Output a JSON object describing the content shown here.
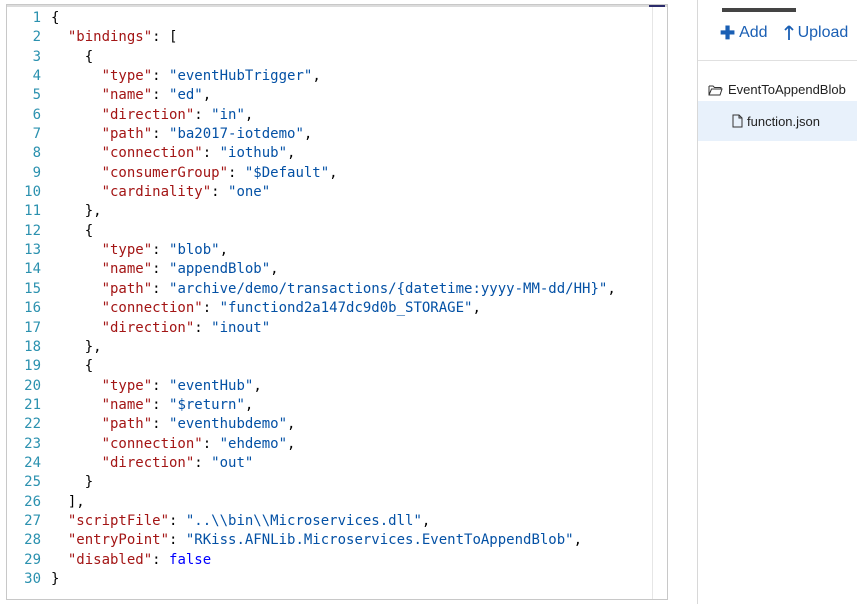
{
  "editor": {
    "lines": [
      [
        {
          "t": "p",
          "v": "{"
        }
      ],
      [
        {
          "t": "p",
          "v": "  "
        },
        {
          "t": "k",
          "v": "\"bindings\""
        },
        {
          "t": "p",
          "v": ": ["
        }
      ],
      [
        {
          "t": "p",
          "v": "    {"
        }
      ],
      [
        {
          "t": "p",
          "v": "      "
        },
        {
          "t": "k",
          "v": "\"type\""
        },
        {
          "t": "p",
          "v": ": "
        },
        {
          "t": "s",
          "v": "\"eventHubTrigger\""
        },
        {
          "t": "p",
          "v": ","
        }
      ],
      [
        {
          "t": "p",
          "v": "      "
        },
        {
          "t": "k",
          "v": "\"name\""
        },
        {
          "t": "p",
          "v": ": "
        },
        {
          "t": "s",
          "v": "\"ed\""
        },
        {
          "t": "p",
          "v": ","
        }
      ],
      [
        {
          "t": "p",
          "v": "      "
        },
        {
          "t": "k",
          "v": "\"direction\""
        },
        {
          "t": "p",
          "v": ": "
        },
        {
          "t": "s",
          "v": "\"in\""
        },
        {
          "t": "p",
          "v": ","
        }
      ],
      [
        {
          "t": "p",
          "v": "      "
        },
        {
          "t": "k",
          "v": "\"path\""
        },
        {
          "t": "p",
          "v": ": "
        },
        {
          "t": "s",
          "v": "\"ba2017-iotdemo\""
        },
        {
          "t": "p",
          "v": ","
        }
      ],
      [
        {
          "t": "p",
          "v": "      "
        },
        {
          "t": "k",
          "v": "\"connection\""
        },
        {
          "t": "p",
          "v": ": "
        },
        {
          "t": "s",
          "v": "\"iothub\""
        },
        {
          "t": "p",
          "v": ","
        }
      ],
      [
        {
          "t": "p",
          "v": "      "
        },
        {
          "t": "k",
          "v": "\"consumerGroup\""
        },
        {
          "t": "p",
          "v": ": "
        },
        {
          "t": "s",
          "v": "\"$Default\""
        },
        {
          "t": "p",
          "v": ","
        }
      ],
      [
        {
          "t": "p",
          "v": "      "
        },
        {
          "t": "k",
          "v": "\"cardinality\""
        },
        {
          "t": "p",
          "v": ": "
        },
        {
          "t": "s",
          "v": "\"one\""
        }
      ],
      [
        {
          "t": "p",
          "v": "    },"
        }
      ],
      [
        {
          "t": "p",
          "v": "    {"
        }
      ],
      [
        {
          "t": "p",
          "v": "      "
        },
        {
          "t": "k",
          "v": "\"type\""
        },
        {
          "t": "p",
          "v": ": "
        },
        {
          "t": "s",
          "v": "\"blob\""
        },
        {
          "t": "p",
          "v": ","
        }
      ],
      [
        {
          "t": "p",
          "v": "      "
        },
        {
          "t": "k",
          "v": "\"name\""
        },
        {
          "t": "p",
          "v": ": "
        },
        {
          "t": "s",
          "v": "\"appendBlob\""
        },
        {
          "t": "p",
          "v": ","
        }
      ],
      [
        {
          "t": "p",
          "v": "      "
        },
        {
          "t": "k",
          "v": "\"path\""
        },
        {
          "t": "p",
          "v": ": "
        },
        {
          "t": "s",
          "v": "\"archive/demo/transactions/{datetime:yyyy-MM-dd/HH}\""
        },
        {
          "t": "p",
          "v": ","
        }
      ],
      [
        {
          "t": "p",
          "v": "      "
        },
        {
          "t": "k",
          "v": "\"connection\""
        },
        {
          "t": "p",
          "v": ": "
        },
        {
          "t": "s",
          "v": "\"functiond2a147dc9d0b_STORAGE\""
        },
        {
          "t": "p",
          "v": ","
        }
      ],
      [
        {
          "t": "p",
          "v": "      "
        },
        {
          "t": "k",
          "v": "\"direction\""
        },
        {
          "t": "p",
          "v": ": "
        },
        {
          "t": "s",
          "v": "\"inout\""
        }
      ],
      [
        {
          "t": "p",
          "v": "    },"
        }
      ],
      [
        {
          "t": "p",
          "v": "    {"
        }
      ],
      [
        {
          "t": "p",
          "v": "      "
        },
        {
          "t": "k",
          "v": "\"type\""
        },
        {
          "t": "p",
          "v": ": "
        },
        {
          "t": "s",
          "v": "\"eventHub\""
        },
        {
          "t": "p",
          "v": ","
        }
      ],
      [
        {
          "t": "p",
          "v": "      "
        },
        {
          "t": "k",
          "v": "\"name\""
        },
        {
          "t": "p",
          "v": ": "
        },
        {
          "t": "s",
          "v": "\"$return\""
        },
        {
          "t": "p",
          "v": ","
        }
      ],
      [
        {
          "t": "p",
          "v": "      "
        },
        {
          "t": "k",
          "v": "\"path\""
        },
        {
          "t": "p",
          "v": ": "
        },
        {
          "t": "s",
          "v": "\"eventhubdemo\""
        },
        {
          "t": "p",
          "v": ","
        }
      ],
      [
        {
          "t": "p",
          "v": "      "
        },
        {
          "t": "k",
          "v": "\"connection\""
        },
        {
          "t": "p",
          "v": ": "
        },
        {
          "t": "s",
          "v": "\"ehdemo\""
        },
        {
          "t": "p",
          "v": ","
        }
      ],
      [
        {
          "t": "p",
          "v": "      "
        },
        {
          "t": "k",
          "v": "\"direction\""
        },
        {
          "t": "p",
          "v": ": "
        },
        {
          "t": "s",
          "v": "\"out\""
        }
      ],
      [
        {
          "t": "p",
          "v": "    }"
        }
      ],
      [
        {
          "t": "p",
          "v": "  ],"
        }
      ],
      [
        {
          "t": "p",
          "v": "  "
        },
        {
          "t": "k",
          "v": "\"scriptFile\""
        },
        {
          "t": "p",
          "v": ": "
        },
        {
          "t": "s",
          "v": "\"..\\\\bin\\\\Microservices.dll\""
        },
        {
          "t": "p",
          "v": ","
        }
      ],
      [
        {
          "t": "p",
          "v": "  "
        },
        {
          "t": "k",
          "v": "\"entryPoint\""
        },
        {
          "t": "p",
          "v": ": "
        },
        {
          "t": "s",
          "v": "\"RKiss.AFNLib.Microservices.EventToAppendBlob\""
        },
        {
          "t": "p",
          "v": ","
        }
      ],
      [
        {
          "t": "p",
          "v": "  "
        },
        {
          "t": "k",
          "v": "\"disabled\""
        },
        {
          "t": "p",
          "v": ": "
        },
        {
          "t": "b",
          "v": "false"
        }
      ],
      [
        {
          "t": "p",
          "v": "}"
        }
      ]
    ]
  },
  "sidebar": {
    "add_label": "Add",
    "upload_label": "Upload",
    "folder_name": "EventToAppendBlob",
    "file_name": "function.json"
  },
  "icons": {
    "add": "plus-icon",
    "upload": "upload-arrow-icon",
    "folder": "folder-icon",
    "file": "file-icon"
  },
  "colors": {
    "line_number": "#2b91af",
    "key": "#a31515",
    "string": "#0451a5",
    "keyword": "#0000ff",
    "accent": "#1a5fb4",
    "selected_file_bg": "#e8f1fb"
  }
}
